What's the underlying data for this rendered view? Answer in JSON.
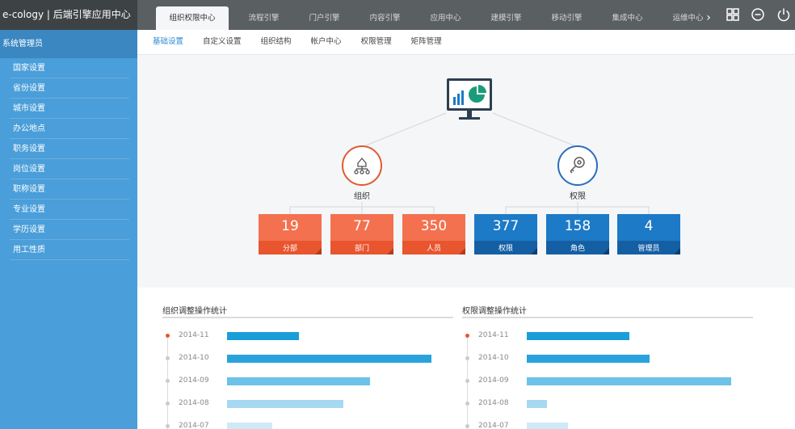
{
  "app": {
    "title": "e-cology | 后端引擎应用中心"
  },
  "topnav": {
    "tabs": [
      {
        "label": "组织权限中心",
        "active": true
      },
      {
        "label": "流程引擎"
      },
      {
        "label": "门户引擎"
      },
      {
        "label": "内容引擎"
      },
      {
        "label": "应用中心"
      },
      {
        "label": "建模引擎"
      },
      {
        "label": "移动引擎"
      },
      {
        "label": "集成中心"
      },
      {
        "label": "运维中心"
      }
    ],
    "more": "›",
    "icons": [
      "grid-icon",
      "minus-circle-icon",
      "power-icon"
    ]
  },
  "sidebar": {
    "title": "系统管理员",
    "items": [
      {
        "label": "国家设置"
      },
      {
        "label": "省份设置"
      },
      {
        "label": "城市设置"
      },
      {
        "label": "办公地点"
      },
      {
        "label": "职务设置"
      },
      {
        "label": "岗位设置"
      },
      {
        "label": "职称设置"
      },
      {
        "label": "专业设置"
      },
      {
        "label": "学历设置"
      },
      {
        "label": "用工性质"
      }
    ]
  },
  "subnav": {
    "items": [
      {
        "label": "基础设置",
        "active": true
      },
      {
        "label": "自定义设置"
      },
      {
        "label": "组织结构"
      },
      {
        "label": "帐户中心"
      },
      {
        "label": "权限管理"
      },
      {
        "label": "矩阵管理"
      }
    ]
  },
  "diagram": {
    "org_label": "组织",
    "perm_label": "权限",
    "cards": [
      {
        "value": "19",
        "label": "分部",
        "color": "orange"
      },
      {
        "value": "77",
        "label": "部门",
        "color": "orange"
      },
      {
        "value": "350",
        "label": "人员",
        "color": "orange"
      },
      {
        "value": "377",
        "label": "权限",
        "color": "blue"
      },
      {
        "value": "158",
        "label": "角色",
        "color": "blue"
      },
      {
        "value": "4",
        "label": "管理员",
        "color": "blue"
      }
    ],
    "colors": {
      "orange": "#f4714f",
      "blue": "#1c7ac7",
      "org_ring": "#e05a33",
      "perm_ring": "#2b6cbf"
    }
  },
  "stats": {
    "org": {
      "title": "组织调整操作统计",
      "rows": [
        {
          "period": "2014-11",
          "level": 0.35,
          "active": true
        },
        {
          "period": "2014-10",
          "level": 1.0
        },
        {
          "period": "2014-09",
          "level": 0.7
        },
        {
          "period": "2014-08",
          "level": 0.57
        },
        {
          "period": "2014-07",
          "level": 0.22
        }
      ]
    },
    "perm": {
      "title": "权限调整操作统计",
      "rows": [
        {
          "period": "2014-11",
          "level": 0.5,
          "active": true
        },
        {
          "period": "2014-10",
          "level": 0.6
        },
        {
          "period": "2014-09",
          "level": 1.0
        },
        {
          "period": "2014-08",
          "level": 0.1
        },
        {
          "period": "2014-07",
          "level": 0.2
        }
      ]
    },
    "bar_colors": [
      "#1a9ed9",
      "#2aa3dc",
      "#6cc2e8",
      "#a6d9f1",
      "#cfe9f7"
    ]
  }
}
